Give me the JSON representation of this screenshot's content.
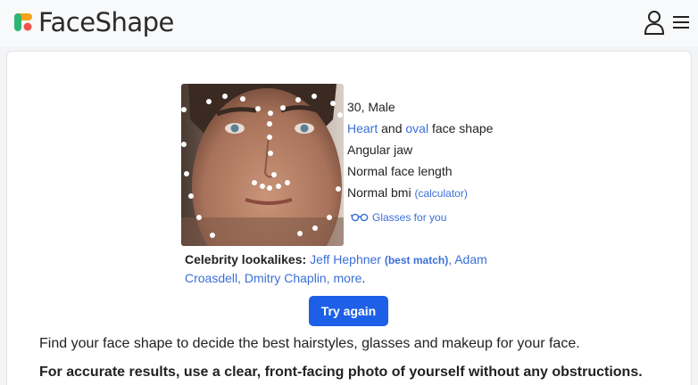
{
  "header": {
    "brand": "FaceShape",
    "colors": {
      "mark_orange": "#f4a31c",
      "mark_green": "#2bb673",
      "mark_red": "#ef5350"
    }
  },
  "result": {
    "age_gender": "30, Male",
    "face_shape": {
      "heart": "Heart",
      "and": " and ",
      "oval": "oval",
      "suffix": " face shape"
    },
    "jaw": "Angular jaw",
    "length": "Normal face length",
    "bmi": "Normal bmi",
    "bmi_link": "(calculator)",
    "glasses_link": "Glasses for you"
  },
  "celebrities": {
    "label": "Celebrity lookalikes:",
    "first": "Jeff Hephner",
    "best_match": "(best match)",
    "rest": "Adam Croasdell, Dmitry Chaplin, more",
    "sep": ", ",
    "end": "."
  },
  "actions": {
    "try_again": "Try again"
  },
  "text": {
    "description": "Find your face shape to decide the best hairstyles, glasses and makeup for your face.",
    "tip": "For accurate results, use a clear, front-facing photo of yourself without any obstructions."
  }
}
